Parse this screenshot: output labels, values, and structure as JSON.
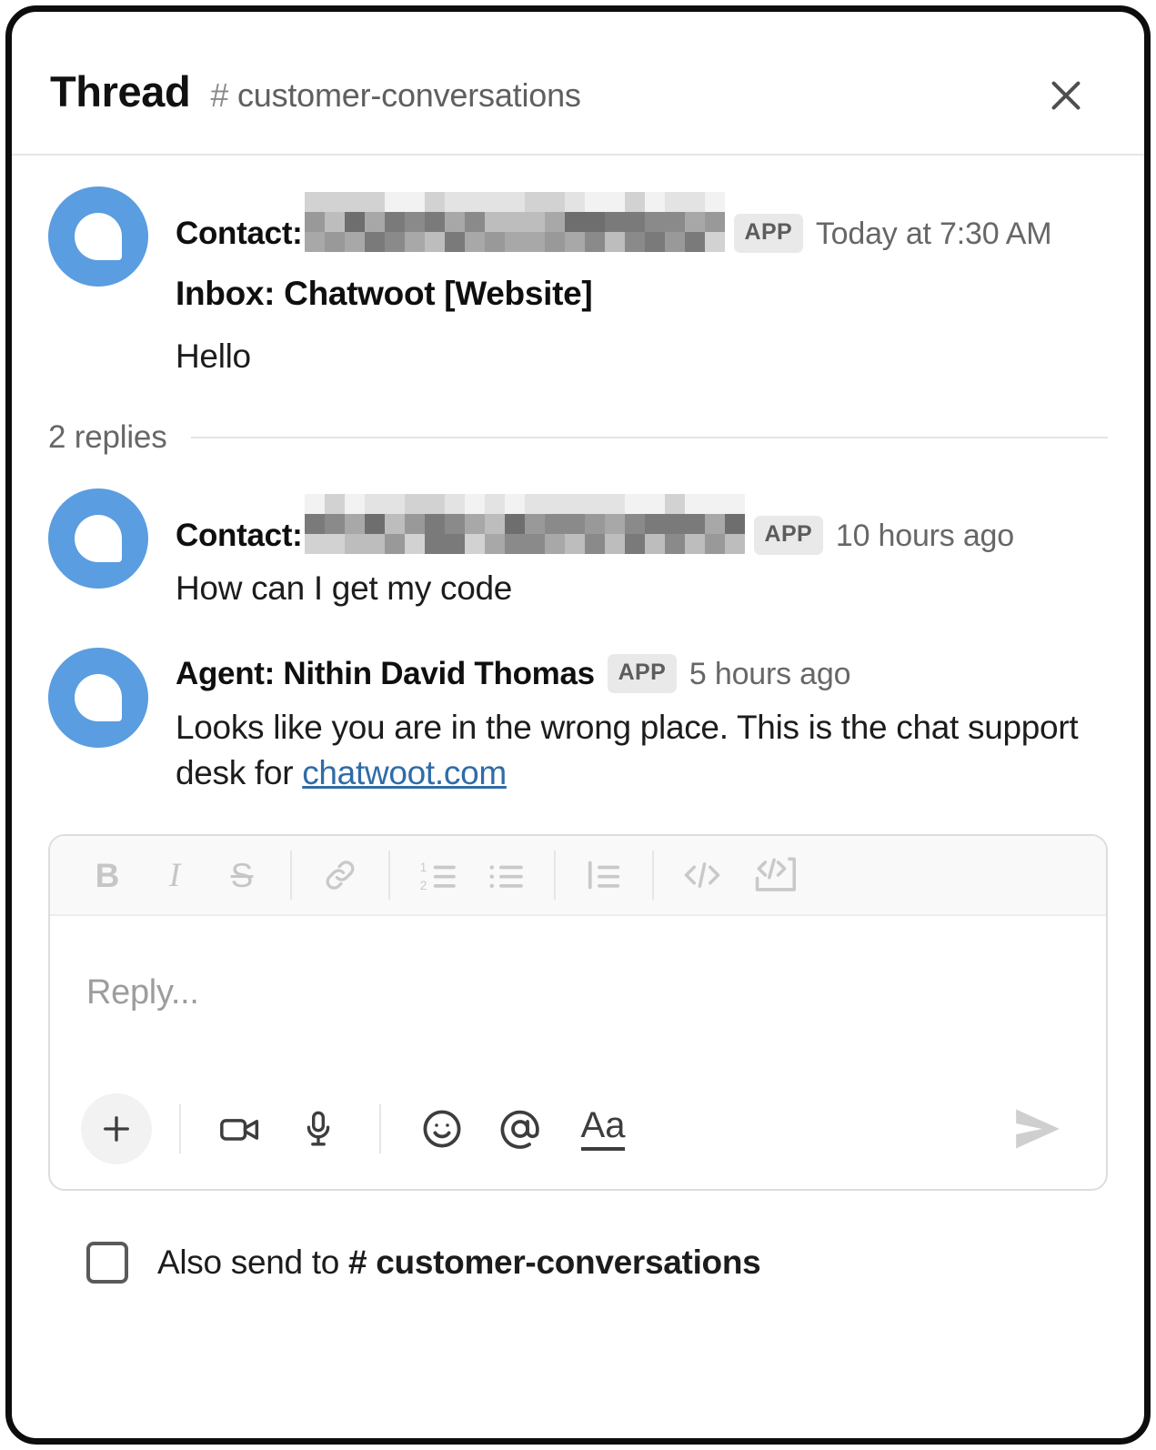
{
  "header": {
    "title": "Thread",
    "channel_hash": "#",
    "channel": "customer-conversations",
    "close_icon": "close-icon"
  },
  "thread": {
    "root": {
      "sender": "Contact:",
      "sender_name_redacted": true,
      "badge": "APP",
      "timestamp": "Today at 7:30 AM",
      "lines": [
        {
          "text": "Inbox: Chatwoot [Website]",
          "bold": true
        },
        {
          "text": "Hello",
          "bold": false
        }
      ]
    },
    "replies_label": "2 replies",
    "replies": [
      {
        "sender": "Contact:",
        "sender_name_redacted": true,
        "badge": "APP",
        "timestamp": "10 hours ago",
        "text": "How can I get my code"
      },
      {
        "sender": "Agent: Nithin David Thomas",
        "sender_name_redacted": false,
        "badge": "APP",
        "timestamp": "5 hours ago",
        "text_before_link": "Looks like you are in the wrong place. This is the chat support desk for ",
        "link_text": "chatwoot.com"
      }
    ]
  },
  "composer": {
    "placeholder": "Reply...",
    "format_buttons": [
      {
        "name": "bold-button",
        "glyph": "B"
      },
      {
        "name": "italic-button",
        "glyph": "I"
      },
      {
        "name": "strikethrough-button",
        "glyph": "S"
      },
      {
        "name": "link-button",
        "glyph": "link-icon"
      },
      {
        "name": "ordered-list-button",
        "glyph": "ordered-list-icon"
      },
      {
        "name": "bulleted-list-button",
        "glyph": "bulleted-list-icon"
      },
      {
        "name": "blockquote-button",
        "glyph": "blockquote-icon"
      },
      {
        "name": "code-button",
        "glyph": "code-icon"
      },
      {
        "name": "code-block-button",
        "glyph": "code-block-icon"
      }
    ],
    "action_buttons": [
      {
        "name": "attach-button",
        "glyph": "plus-icon"
      },
      {
        "name": "video-button",
        "glyph": "video-camera-icon"
      },
      {
        "name": "audio-button",
        "glyph": "microphone-icon"
      },
      {
        "name": "emoji-button",
        "glyph": "smiley-icon"
      },
      {
        "name": "mention-button",
        "glyph": "at-icon"
      },
      {
        "name": "formatting-button",
        "glyph": "Aa"
      }
    ],
    "send_icon": "send-icon"
  },
  "also_send": {
    "checked": false,
    "label_prefix": "Also send to ",
    "label_hash": "# ",
    "label_channel": "customer-conversations"
  },
  "colors": {
    "avatar_blue": "#5a9de0",
    "link_blue": "#2f6ca8",
    "badge_bg": "#e9e9e9",
    "text": "#1d1c1d",
    "muted": "#676767",
    "frame": "#0d0d0d"
  }
}
